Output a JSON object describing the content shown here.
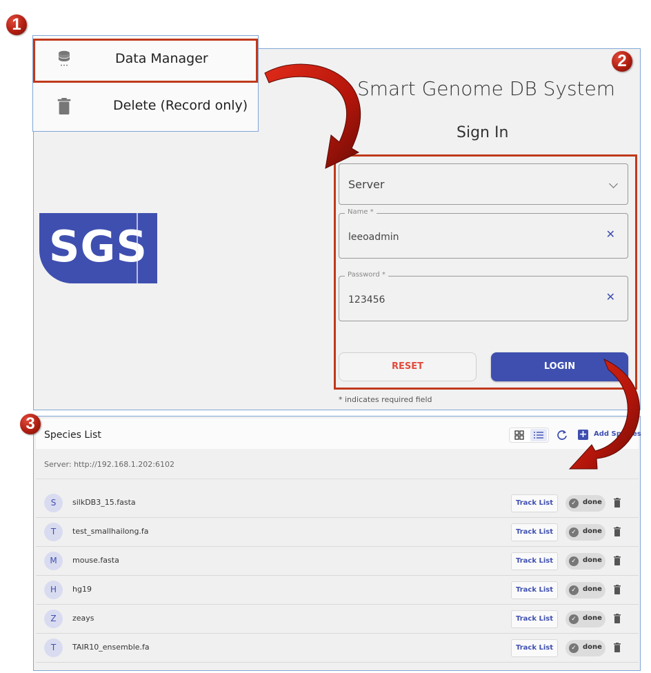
{
  "badges": {
    "step1": "1",
    "step2": "2",
    "step3": "3"
  },
  "menu": {
    "items": [
      {
        "label": "Data Manager",
        "icon": "database-icon"
      },
      {
        "label": "Delete (Record only)",
        "icon": "trash-icon"
      }
    ]
  },
  "login": {
    "app_title": "Smart Genome DB System",
    "heading": "Sign In",
    "logo_text": "SGS",
    "server": {
      "value": "Server"
    },
    "name": {
      "label": "Name *",
      "value": "leeoadmin"
    },
    "password": {
      "label": "Password *",
      "value": "123456"
    },
    "reset_label": "RESET",
    "login_label": "LOGIN",
    "required_note": "* indicates required field"
  },
  "species": {
    "title": "Species List",
    "server_url": "Server: http://192.168.1.202:6102",
    "add_label": "Add Species",
    "track_label": "Track List",
    "status_label": "done",
    "rows": [
      {
        "initial": "S",
        "name": "silkDB3_15.fasta"
      },
      {
        "initial": "T",
        "name": "test_smallhailong.fa"
      },
      {
        "initial": "M",
        "name": "mouse.fasta"
      },
      {
        "initial": "H",
        "name": "hg19"
      },
      {
        "initial": "Z",
        "name": "zeays"
      },
      {
        "initial": "T",
        "name": "TAIR10_ensemble.fa"
      }
    ]
  },
  "colors": {
    "accent": "#3f4fb0",
    "highlight": "#c0391b",
    "reset": "#e24b3d",
    "badge": "#b01e12"
  }
}
